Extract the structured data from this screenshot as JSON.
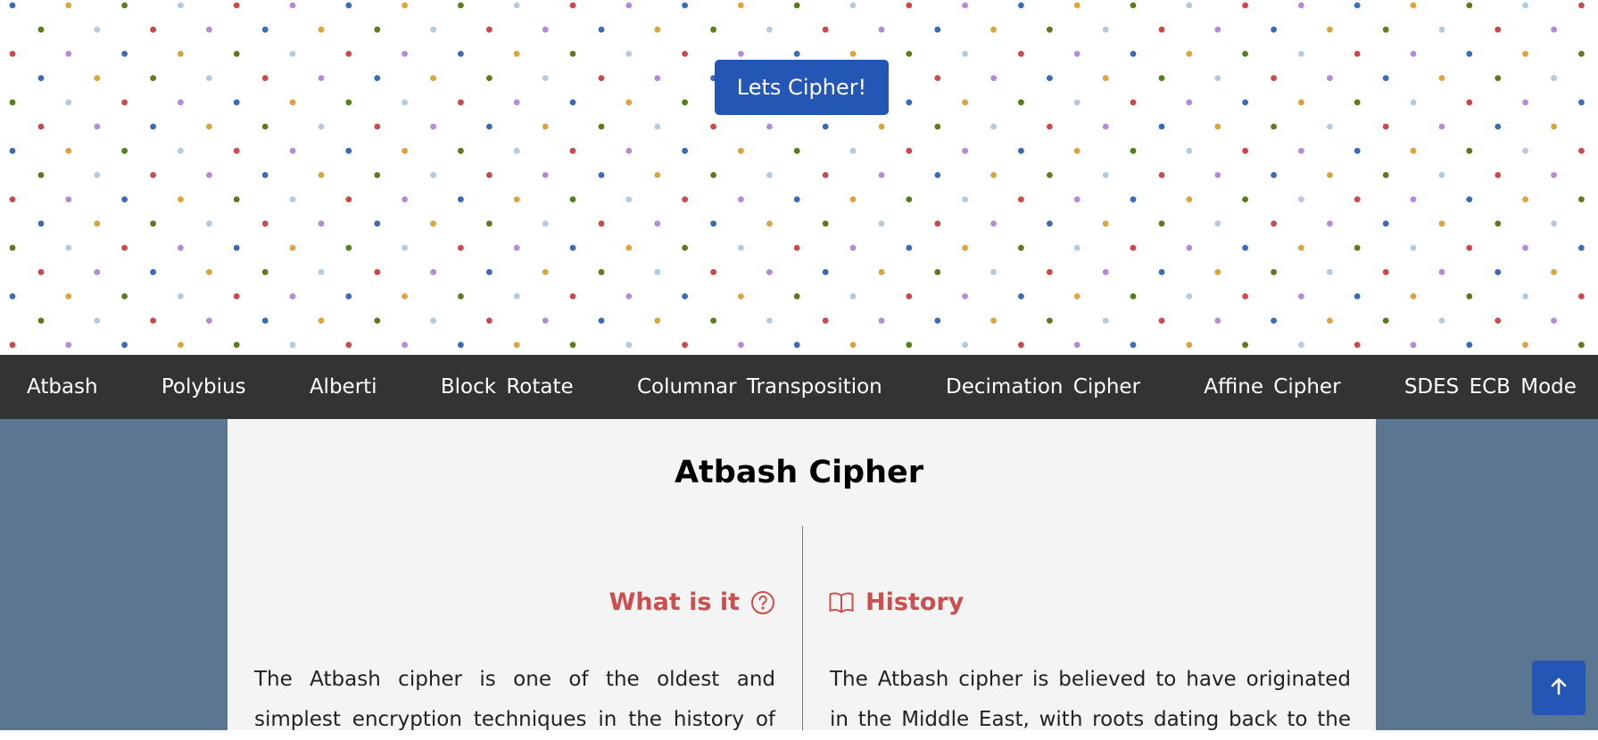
{
  "hero": {
    "cta_label": "Lets Cipher!",
    "dot_colors": [
      "#3b6bb3",
      "#d9a441",
      "#5c7a1f",
      "#b3cbe0",
      "#c94a4a",
      "#b58ad6"
    ]
  },
  "nav": {
    "items": [
      {
        "label": "Atbash"
      },
      {
        "label": "Polybius"
      },
      {
        "label": "Alberti"
      },
      {
        "label": "Block Rotate"
      },
      {
        "label": "Columnar Transposition"
      },
      {
        "label": "Decimation Cipher"
      },
      {
        "label": "Affine Cipher"
      },
      {
        "label": "SDES ECB Mode"
      }
    ]
  },
  "main": {
    "title": "Atbash Cipher",
    "what_is_it": {
      "heading": "What is it",
      "icon": "question-circle-icon",
      "text_lines": [
        "The Atbash cipher is one of the oldest and",
        "simplest encryption techniques in the history of"
      ]
    },
    "history": {
      "heading": "History",
      "icon": "book-open-icon",
      "text_lines": [
        "The Atbash cipher is believed to have originated",
        "in the Middle East, with roots dating back to the"
      ]
    }
  },
  "scroll_top": {
    "icon": "arrow-up-icon"
  },
  "colors": {
    "accent": "#2356b5",
    "nav_bg": "#333333",
    "page_bg": "#5b7690",
    "card_bg": "#f4f4f4",
    "heading_red": "#cc4e4e"
  }
}
